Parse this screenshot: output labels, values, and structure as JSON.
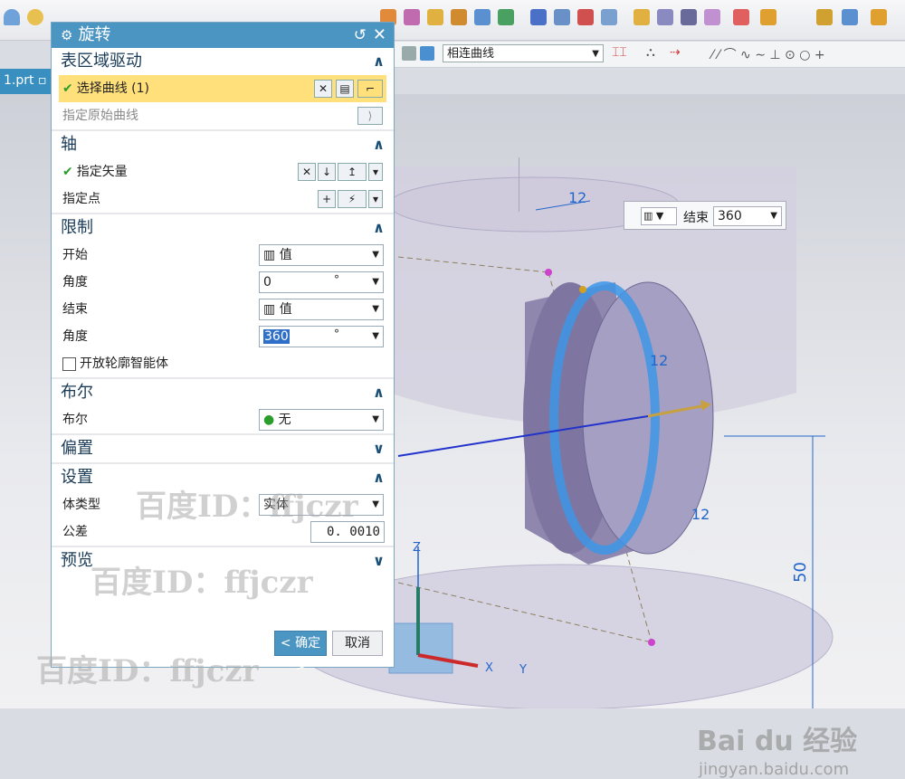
{
  "toolbar": {
    "icons": [
      "cone-icon",
      "sphere-icon",
      "extrude-icon",
      "revolve-icon",
      "block-icon",
      "pattern-icon",
      "unite-icon",
      "subtract-icon",
      "intersect-icon",
      "trim-icon",
      "blend-icon",
      "chamfer-icon",
      "shell-icon",
      "draft-icon",
      "mirror-icon",
      "move-icon"
    ],
    "curve_rule": "相连曲线"
  },
  "file_tab": {
    "label": "1.prt"
  },
  "dialog": {
    "title": "旋转",
    "sections": {
      "section_drive": {
        "title": "表区域驱动",
        "select_curve": "选择曲线 (1)",
        "spec_orig_curve": "指定原始曲线"
      },
      "axis": {
        "title": "轴",
        "spec_vector": "指定矢量",
        "spec_point": "指定点"
      },
      "limits": {
        "title": "限制",
        "start_label": "开始",
        "start_value": "值",
        "angle1_label": "角度",
        "angle1_value": "0",
        "angle1_unit": "°",
        "end_label": "结束",
        "end_value": "值",
        "angle2_label": "角度",
        "angle2_value": "360",
        "angle2_unit": "°",
        "open_profile": "开放轮廓智能体"
      },
      "boolean": {
        "title": "布尔",
        "label": "布尔",
        "value": "无"
      },
      "offset": {
        "title": "偏置"
      },
      "settings": {
        "title": "设置",
        "body_type_label": "体类型",
        "body_type_value": "实体",
        "tolerance_label": "公差",
        "tolerance_value": "0. 0010"
      },
      "preview": {
        "title": "预览"
      }
    },
    "ok": "< 确定 >",
    "cancel": "取消"
  },
  "end_box": {
    "label": "结束",
    "value": "360"
  },
  "dims": {
    "d1": "12",
    "d2": "12",
    "d3": "12",
    "d4": "50"
  },
  "axis_labels": {
    "z": "Z",
    "x": "X",
    "y": "Y"
  },
  "watermarks": [
    "百度ID：ffjczr",
    "百度ID：ffjczr",
    "百度ID：ffjczr"
  ],
  "baidu": {
    "brand": "Bai du 经验",
    "url": "jingyan.baidu.com"
  },
  "colors": {
    "title_bar": "#4b95c3",
    "selection": "#ffe07a",
    "part": "#8a82a8"
  }
}
